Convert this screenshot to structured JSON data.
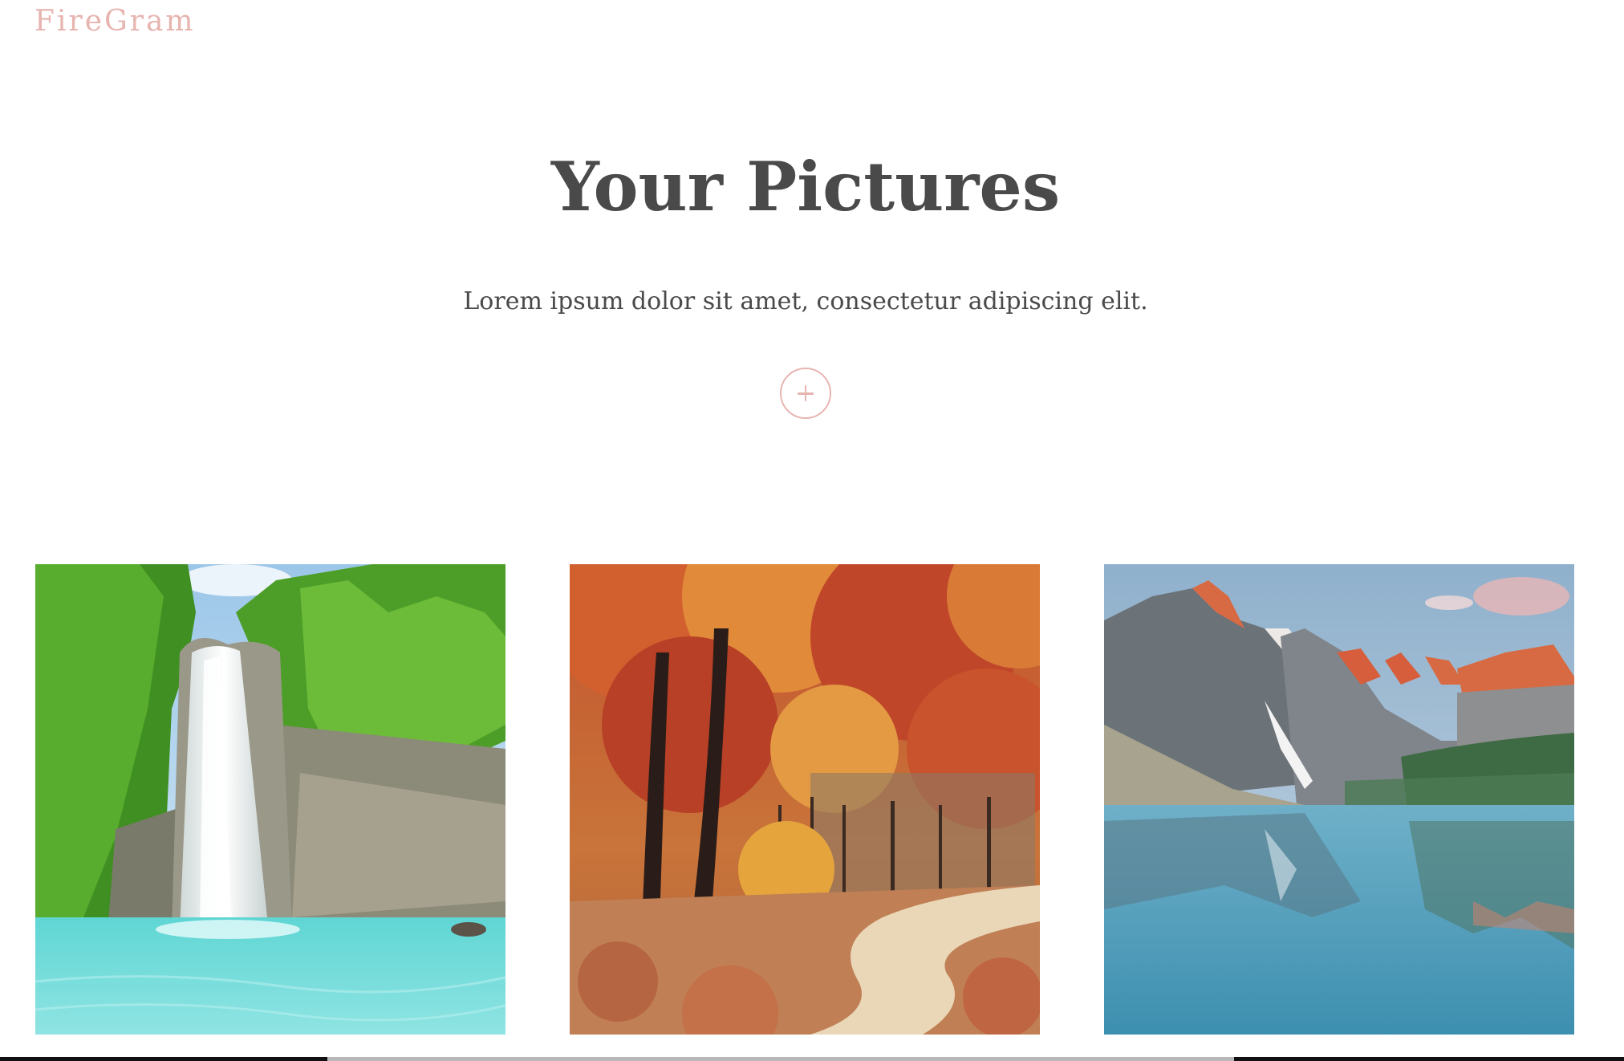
{
  "header": {
    "brand": "FireGram"
  },
  "main": {
    "title": "Your Pictures",
    "subtitle": "Lorem ipsum dolor sit amet, consectetur adipiscing elit.",
    "upload_button_icon": "plus-icon"
  },
  "gallery": {
    "images": [
      {
        "subject": "waterfall"
      },
      {
        "subject": "autumn-forest-path"
      },
      {
        "subject": "mountain-lake"
      }
    ]
  },
  "colors": {
    "accent": "#e7b4b0",
    "text": "#4a4a4a",
    "background": "#ffffff"
  }
}
